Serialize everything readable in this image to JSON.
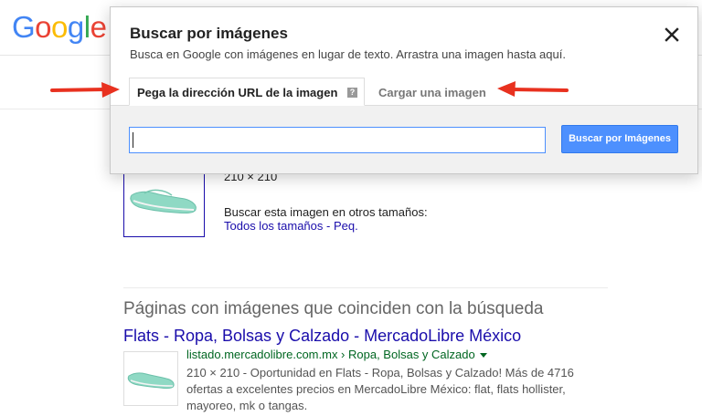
{
  "logo": {
    "letters": [
      "G",
      "o",
      "o",
      "g",
      "l",
      "e"
    ],
    "colors": [
      "#4285f4",
      "#ea4335",
      "#fbbc05",
      "#4285f4",
      "#34a853",
      "#ea4335"
    ]
  },
  "dialog": {
    "title": "Buscar por imágenes",
    "subtitle": "Busca en Google con imágenes en lugar de texto. Arrastra una imagen hasta aquí.",
    "tabs": {
      "url_label": "Pega la dirección URL de la imagen",
      "help_glyph": "?",
      "upload_label": "Cargar una imagen"
    },
    "input": {
      "value": "",
      "placeholder": ""
    },
    "search_button": "Buscar por Imágenes",
    "close_glyph": "✕"
  },
  "image_result": {
    "dimensions": "210 × 210",
    "other_sizes": "Buscar esta imagen en otros tamaños:",
    "all_sizes_link": "Todos los tamaños",
    "separator": " - ",
    "small_link": "Peq."
  },
  "matching_pages": {
    "heading": "Páginas con imágenes que coinciden con la búsqueda",
    "results": [
      {
        "title": "Flats - Ropa, Bolsas y Calzado - MercadoLibre México",
        "url": "listado.mercadolibre.com.mx › Ropa, Bolsas y Calzado",
        "snippet": "210 × 210 - Oportunidad en Flats - Ropa, Bolsas y Calzado! Más de 4716 ofertas a excelentes precios en MercadoLibre México: flat, flats hollister, mayoreo, mk o tangas."
      }
    ]
  },
  "colors": {
    "accent": "#4d90fe",
    "link": "#1a0dab",
    "url_green": "#006621",
    "annotation_red": "#e8311f",
    "shoe": "#8fd9c4"
  }
}
